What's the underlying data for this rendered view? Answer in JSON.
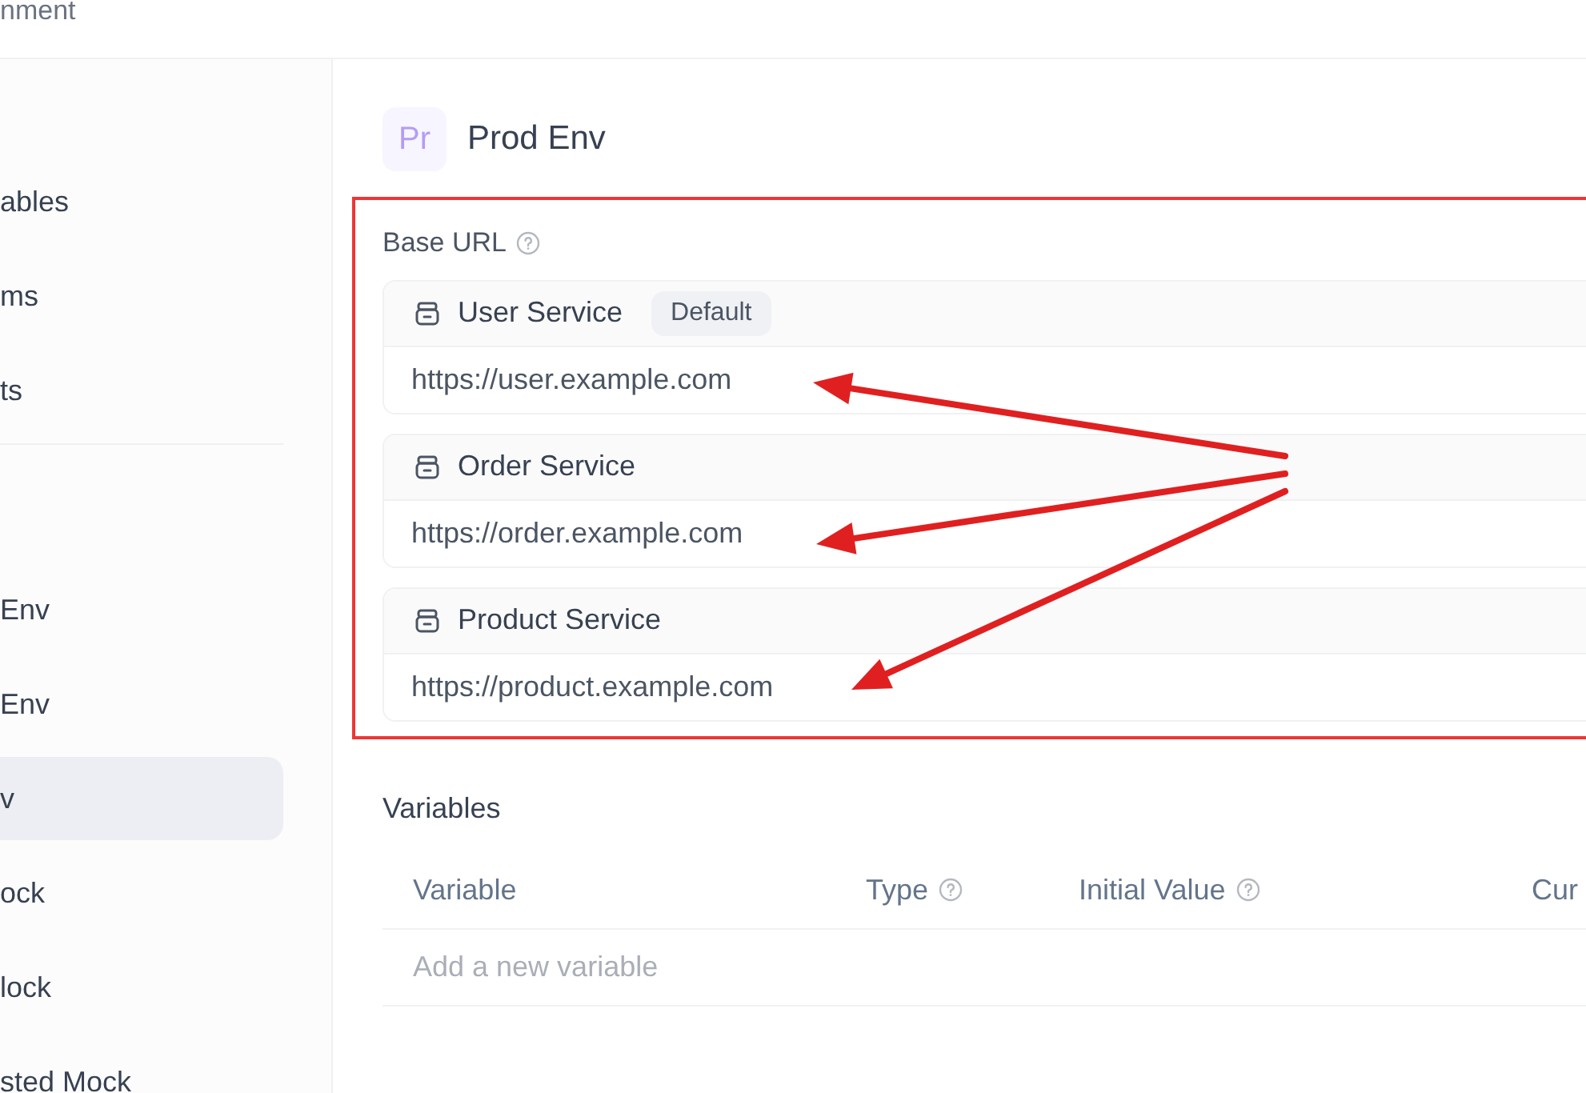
{
  "header": {
    "title": "nment"
  },
  "sidebar": {
    "items": [
      {
        "label": "ables",
        "selected": false
      },
      {
        "label": "ms",
        "selected": false
      },
      {
        "label": "ts",
        "selected": false
      },
      {
        "label": "Env",
        "selected": false
      },
      {
        "label": "Env",
        "selected": false
      },
      {
        "label": "v",
        "selected": true
      },
      {
        "label": "ock",
        "selected": false
      },
      {
        "label": "lock",
        "selected": false
      },
      {
        "label": "sted Mock",
        "selected": false
      }
    ]
  },
  "environment": {
    "avatar": "Pr",
    "name": "Prod Env"
  },
  "base_url": {
    "label": "Base URL",
    "services": [
      {
        "name": "User Service",
        "badge": "Default",
        "url": "https://user.example.com"
      },
      {
        "name": "Order Service",
        "url": "https://order.example.com"
      },
      {
        "name": "Product Service",
        "url": "https://product.example.com"
      }
    ]
  },
  "variables": {
    "label": "Variables",
    "columns": [
      {
        "label": "Variable",
        "help": false
      },
      {
        "label": "Type",
        "help": true
      },
      {
        "label": "Initial Value",
        "help": true
      },
      {
        "label": "Cur"
      }
    ],
    "placeholder": "Add a new variable"
  }
}
